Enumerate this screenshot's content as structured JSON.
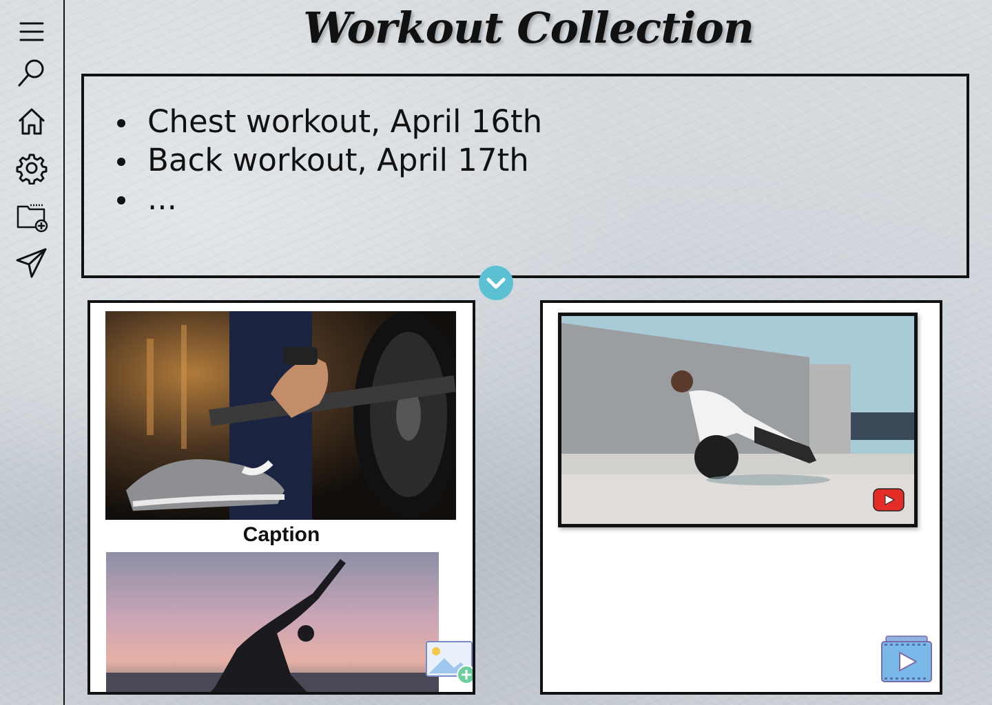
{
  "page": {
    "title": "Workout Collection"
  },
  "sidebar": {
    "items": [
      {
        "icon": "menu-icon"
      },
      {
        "icon": "search-icon"
      },
      {
        "icon": "home-icon"
      },
      {
        "icon": "gear-icon"
      },
      {
        "icon": "new-folder-icon"
      },
      {
        "icon": "send-icon"
      }
    ]
  },
  "notes": {
    "items": [
      "Chest workout, April 16th",
      "Back workout, April 17th",
      "..."
    ],
    "expand_icon": "chevron-down-icon"
  },
  "gallery": {
    "caption": "Caption",
    "add_image_icon": "add-image-icon"
  },
  "video_card": {
    "play_icon": "youtube-play-icon",
    "add_video_icon": "add-video-icon"
  },
  "colors": {
    "accent": "#5bc0d2",
    "youtube_red": "#e52d27",
    "video_icon_blue": "#7ab8ea"
  }
}
